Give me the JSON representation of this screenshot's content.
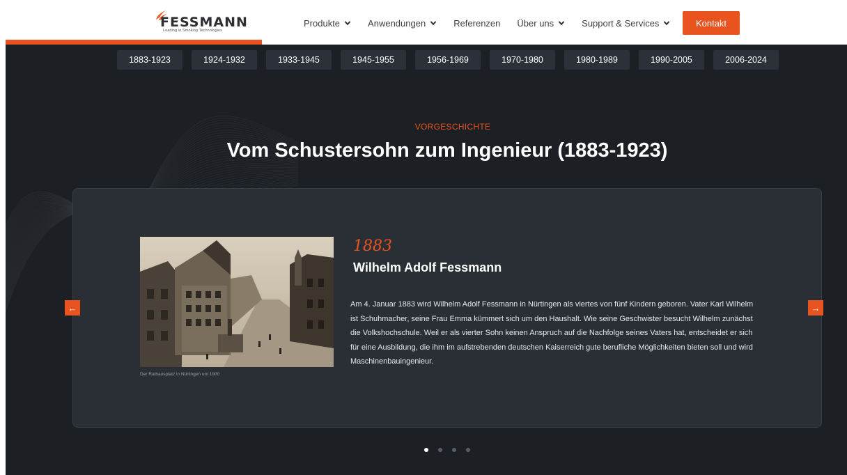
{
  "brand": {
    "name": "FESSMANN",
    "tagline": "Leading in Smoking Technologies",
    "accent": "#e8531f"
  },
  "nav": {
    "items": [
      {
        "label": "Produkte",
        "dropdown": true
      },
      {
        "label": "Anwendungen",
        "dropdown": true
      },
      {
        "label": "Referenzen",
        "dropdown": false
      },
      {
        "label": "Über uns",
        "dropdown": true
      },
      {
        "label": "Support & Services",
        "dropdown": true
      }
    ],
    "cta": "Kontakt"
  },
  "timeline": {
    "tabs": [
      "1883-1923",
      "1924-1932",
      "1933-1945",
      "1945-1955",
      "1956-1969",
      "1970-1980",
      "1980-1989",
      "1990-2005",
      "2006-2024"
    ],
    "progress": 0.305
  },
  "section": {
    "eyebrow": "VORGESCHICHTE",
    "title": "Vom Schustersohn zum Ingenieur (1883-1923)"
  },
  "entry": {
    "year": "1883",
    "title": "Wilhelm Adolf Fessmann",
    "text": "Am 4. Januar 1883 wird Wilhelm Adolf Fessmann in Nürtingen als viertes von fünf Kindern geboren. Vater Karl Wilhelm ist Schuhmacher, seine Frau Emma kümmert sich um den Haushalt. Wie seine Geschwister besucht Wilhelm zunächst die Volkshochschule. Weil er als vierter Sohn keinen Anspruch auf die Nachfolge seines Vaters hat, entscheidet er sich für eine Ausbildung, die ihm im aufstrebenden deutschen Kaiserreich gute berufliche Möglichkeiten bieten soll und wird Maschinenbauingenieur.",
    "image_caption": "Der Rathausplatz in Nürtingen um 1900"
  },
  "carousel": {
    "prev_icon": "arrow-left-icon",
    "next_icon": "arrow-right-icon",
    "prev_glyph": "←",
    "next_glyph": "→",
    "slides": 4,
    "active": 0
  }
}
